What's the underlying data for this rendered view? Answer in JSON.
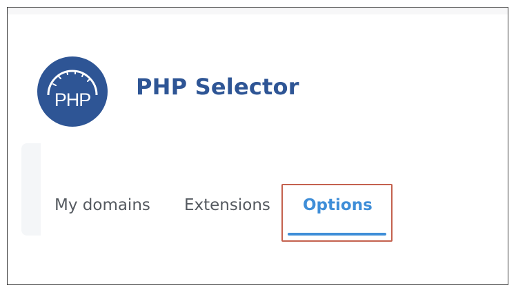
{
  "app": {
    "title": "PHP Selector",
    "logo_text": "PHP",
    "logo_icon": "php-gauge-logo-icon",
    "brand_color": "#2e5595"
  },
  "tabs": [
    {
      "label": "My domains",
      "active": false
    },
    {
      "label": "Extensions",
      "active": false
    },
    {
      "label": "Options",
      "active": true
    }
  ],
  "colors": {
    "active_tab": "#3f8ed8",
    "inactive_tab": "#555a60",
    "highlight": "#c4614e"
  }
}
